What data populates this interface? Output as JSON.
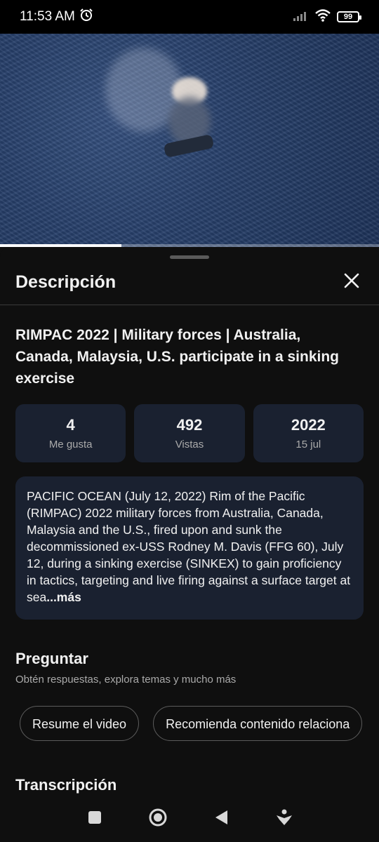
{
  "status": {
    "time": "11:53 AM",
    "battery": "99"
  },
  "video": {
    "progress_fraction": 0.32
  },
  "sheet": {
    "title": "Descripción",
    "video_title": "RIMPAC 2022 | Military forces | Australia, Canada, Malaysia, U.S. participate in a sinking exercise",
    "stats": [
      {
        "value": "4",
        "label": "Me gusta"
      },
      {
        "value": "492",
        "label": "Vistas"
      },
      {
        "value": "2022",
        "label": "15 jul"
      }
    ],
    "description": "PACIFIC OCEAN (July 12, 2022) Rim of the Pacific (RIMPAC) 2022 military forces from Australia, Canada, Malaysia and the U.S., fired upon and sunk the decommissioned ex-USS Rodney M. Davis (FFG 60), July 12, during a sinking exercise (SINKEX) to gain proficiency in tactics, targeting and live firing against a surface target at sea",
    "more_label": "...más",
    "ask": {
      "title": "Preguntar",
      "subtitle": "Obtén respuestas, explora temas y mucho más",
      "chips": [
        "Resume el video",
        "Recomienda contenido relaciona"
      ]
    },
    "transcript_title": "Transcripción"
  },
  "icons": {
    "alarm": "alarm-icon",
    "signal": "signal-icon",
    "wifi": "wifi-icon",
    "close": "close-icon",
    "recents": "square-icon",
    "home": "circle-icon",
    "back": "triangle-back-icon",
    "accessibility": "accessibility-icon"
  }
}
